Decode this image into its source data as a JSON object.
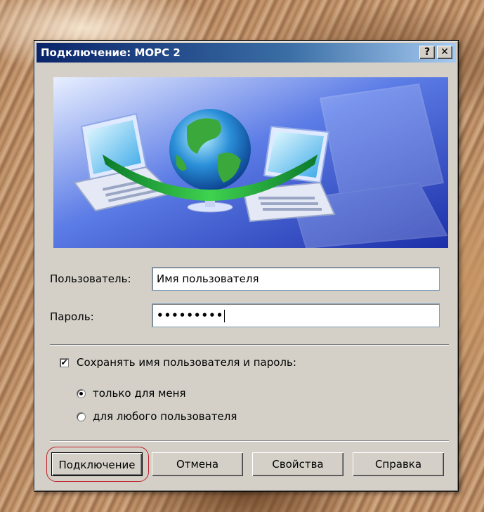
{
  "window": {
    "title": "Подключение: МОРС 2",
    "help_glyph": "?",
    "close_glyph": "✕"
  },
  "form": {
    "user_label": "Пользователь:",
    "user_value": "Имя пользователя",
    "password_label": "Пароль:",
    "password_value": "•••••••••",
    "save_checkbox_label": "Сохранять имя пользователя и пароль:",
    "save_checked": true,
    "radio_only_me": "только для меня",
    "radio_any_user": "для любого пользователя",
    "selected_radio": "only_me"
  },
  "buttons": {
    "connect": "Подключение",
    "cancel": "Отмена",
    "properties": "Свойства",
    "help": "Справка"
  },
  "icons": {
    "banner": "network-connection-illustration",
    "checkbox_mark": "✔"
  }
}
